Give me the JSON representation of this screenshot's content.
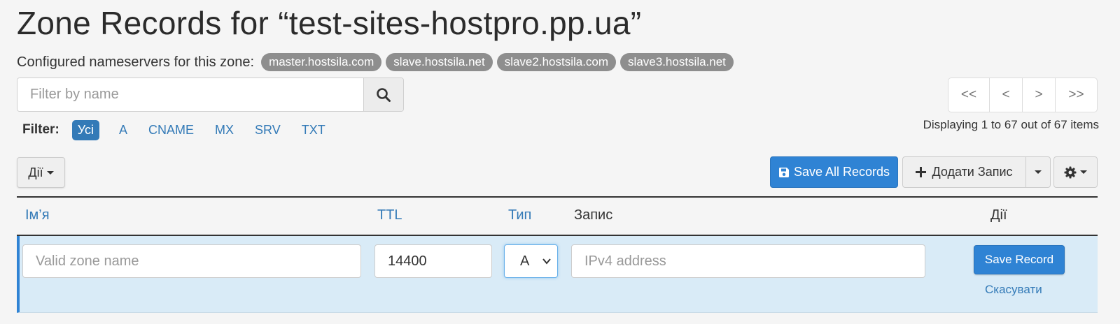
{
  "page": {
    "title": "Zone Records for “test-sites-hostpro.pp.ua”"
  },
  "nameservers": {
    "label": "Configured nameservers for this zone:",
    "items": [
      "master.hostsila.com",
      "slave.hostsila.net",
      "slave2.hostsila.com",
      "slave3.hostsila.net"
    ]
  },
  "search": {
    "placeholder": "Filter by name",
    "icon": "search-icon"
  },
  "type_filter": {
    "label": "Filter:",
    "options": [
      "Усі",
      "A",
      "CNAME",
      "MX",
      "SRV",
      "TXT"
    ],
    "active": "Усі"
  },
  "pager": {
    "first": "<<",
    "prev": "<",
    "next": ">",
    "last": ">>"
  },
  "displaying": "Displaying 1 to 67 out of 67 items",
  "toolbar": {
    "actions_label": "Дії",
    "save_all_label": "Save All Records",
    "add_label": "Додати Запис",
    "gear_icon": "gear-icon"
  },
  "table": {
    "columns": {
      "name": "Ім’я",
      "ttl": "TTL",
      "type": "Тип",
      "record": "Запис",
      "actions": "Дії"
    }
  },
  "edit_row": {
    "name_placeholder": "Valid zone name",
    "ttl_value": "14400",
    "type_value": "A",
    "record_placeholder": "IPv4 address",
    "save_label": "Save Record",
    "cancel_label": "Скасувати"
  },
  "colors": {
    "primary": "#2f83d4",
    "link": "#337ab7",
    "badge": "#8e8e8e",
    "edit_row_bg": "#d9ebf7"
  }
}
